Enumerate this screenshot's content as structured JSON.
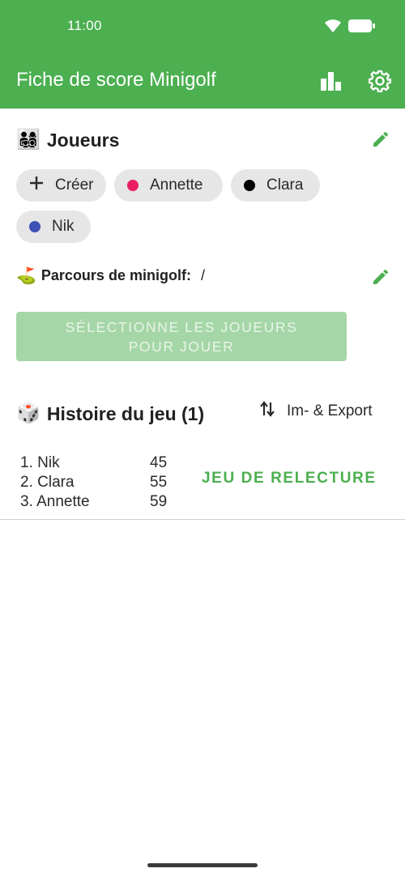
{
  "status_bar": {
    "time": "11:00"
  },
  "app": {
    "title": "Fiche de score Minigolf"
  },
  "players": {
    "title": "Joueurs",
    "create_label": "Créer",
    "list": [
      {
        "name": "Annette",
        "color": "#e91e63"
      },
      {
        "name": "Clara",
        "color": "#000000"
      },
      {
        "name": "Nik",
        "color": "#3f51b5"
      }
    ]
  },
  "course": {
    "label": "Parcours de minigolf:",
    "value": "/"
  },
  "select_button": {
    "label": "SÉLECTIONNE LES JOUEURS POUR JOUER"
  },
  "history": {
    "title": "Histoire du jeu (1)",
    "export_label": "Im- & Export",
    "results": [
      {
        "rank_name": "1. Nik",
        "score": "45"
      },
      {
        "rank_name": "2. Clara",
        "score": "55"
      },
      {
        "rank_name": "3. Annette",
        "score": "59"
      }
    ],
    "replay_label": "JEU DE RELECTURE"
  },
  "colors": {
    "accent": "#4caf50",
    "disabled_button": "#a5d6a7"
  }
}
